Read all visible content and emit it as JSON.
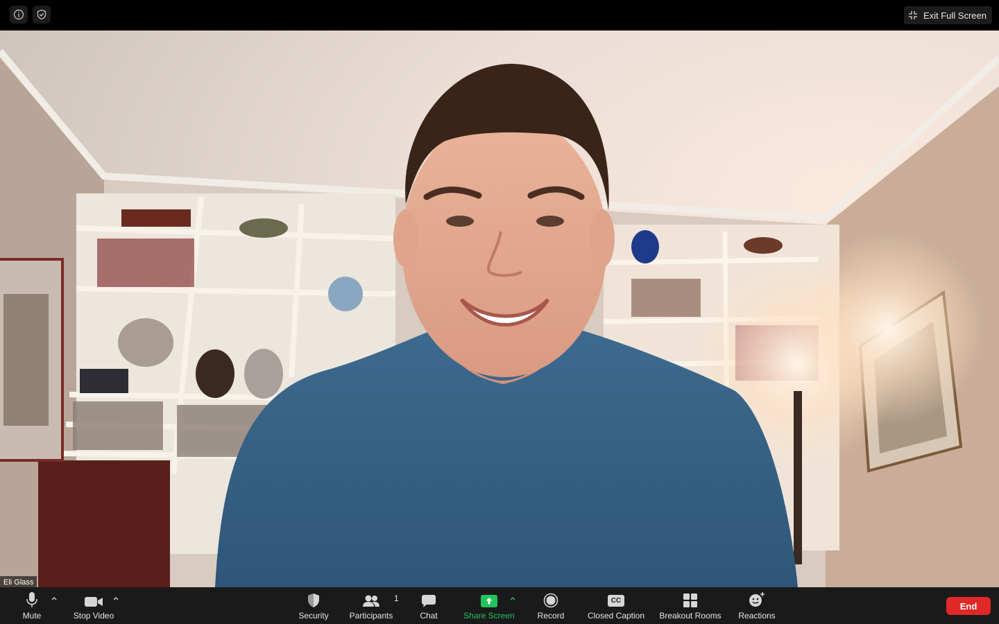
{
  "meeting": {
    "exit_full_screen_label": "Exit Full Screen",
    "participant_name": "Eli Glass"
  },
  "toolbar": {
    "mute_label": "Mute",
    "stop_video_label": "Stop Video",
    "security_label": "Security",
    "participants_label": "Participants",
    "participants_count": "1",
    "chat_label": "Chat",
    "share_screen_label": "Share Screen",
    "record_label": "Record",
    "closed_caption_label": "Closed Caption",
    "closed_caption_glyph": "CC",
    "breakout_rooms_label": "Breakout Rooms",
    "reactions_label": "Reactions",
    "end_label": "End"
  },
  "colors": {
    "share_accent": "#22c35a",
    "end_red": "#e02828"
  },
  "icons": [
    "info-icon",
    "shield-check-icon",
    "exit-full-screen-icon",
    "microphone-icon",
    "video-camera-icon",
    "shield-icon",
    "participants-icon",
    "chat-icon",
    "share-screen-icon",
    "record-icon",
    "closed-caption-icon",
    "breakout-rooms-icon",
    "reactions-icon",
    "chevron-up-icon"
  ]
}
